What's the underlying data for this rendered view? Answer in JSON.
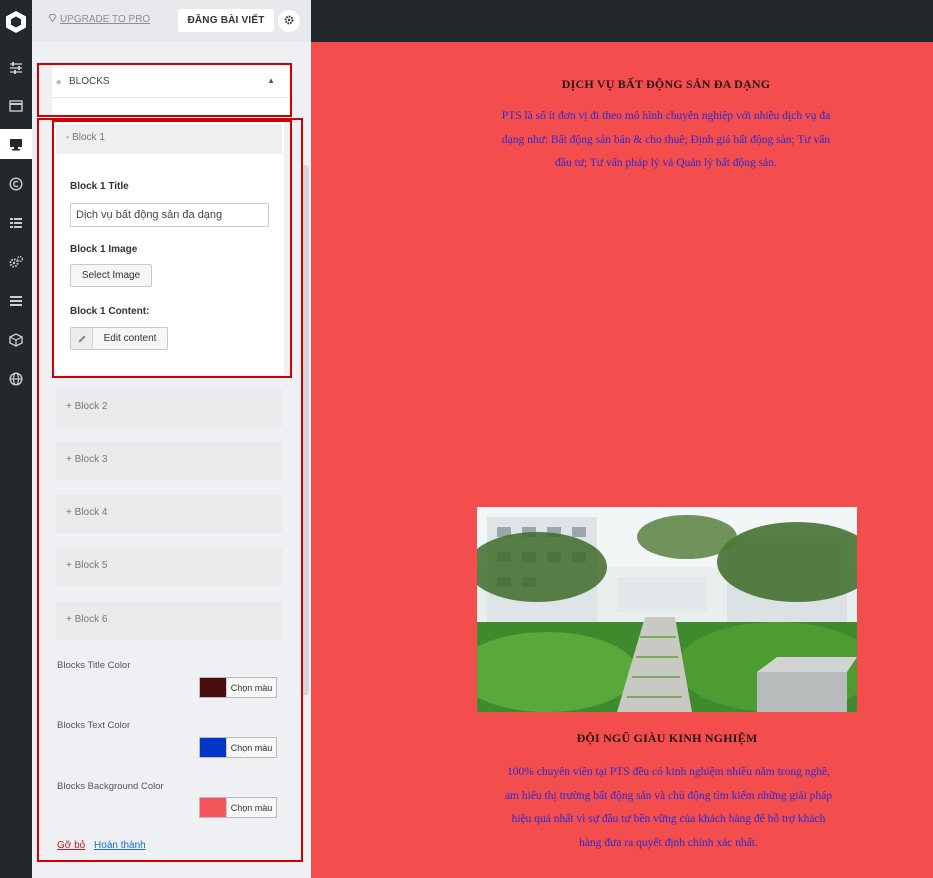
{
  "topbar": {
    "upgrade_label": "UPGRADE TO PRO",
    "publish_label": "ĐĂNG BÀI VIẾT"
  },
  "rail_icons": [
    "logo-icon",
    "sliders-icon",
    "card-icon",
    "monitor-icon",
    "copyright-icon",
    "list-icon",
    "gears-icon",
    "menu-icon",
    "cube-icon",
    "globe-icon"
  ],
  "section": {
    "label": "BLOCKS"
  },
  "block1": {
    "header": "- Block 1",
    "title_label": "Block 1 Title",
    "title_value": "Dịch vụ bất động sản đa dạng",
    "image_label": "Block 1 Image",
    "select_image": "Select Image",
    "content_label": "Block 1 Content:",
    "edit_content": "Edit content"
  },
  "collapsed_blocks": [
    "+ Block 2",
    "+ Block 3",
    "+ Block 4",
    "+ Block 5",
    "+ Block 6"
  ],
  "colors": [
    {
      "label": "Blocks Title Color",
      "button": "Chọn màu",
      "swatch": "#4a0e0e"
    },
    {
      "label": "Blocks Text Color",
      "button": "Chọn màu",
      "swatch": "#0336c6"
    },
    {
      "label": "Blocks Background Color",
      "button": "Chọn màu",
      "swatch": "#f2555a"
    }
  ],
  "footer": {
    "remove": "Gỡ bỏ",
    "done": "Hoàn thành"
  },
  "preview": {
    "background": "#f44d4e",
    "block1_title": "DỊCH VỤ BẤT ĐỘNG SẢN ĐA DẠNG",
    "block1_lines": [
      "PTS là số ít đơn vị đi theo mô hình chuyên nghiệp với nhiều dịch vụ đa",
      "dạng như: Bất động sản bán & cho thuê; Định giá bất động sản; Tư vấn",
      "đầu tư; Tư vấn pháp lý và Quản lý bất động sản."
    ],
    "block2_title": "ĐỘI NGŨ GIÀU KINH NGHIỆM",
    "block2_lines": [
      "100% chuyên viên tại PTS đều có kinh nghiệm nhiều năm trong nghề,",
      "am hiểu thị trường bất động sản và chủ động tìm kiếm những giải pháp",
      "hiệu quả nhất vì sự đầu tư bền vững của khách hàng để hỗ trợ khách",
      "hàng đưa ra quyết định chính xác nhất."
    ]
  }
}
